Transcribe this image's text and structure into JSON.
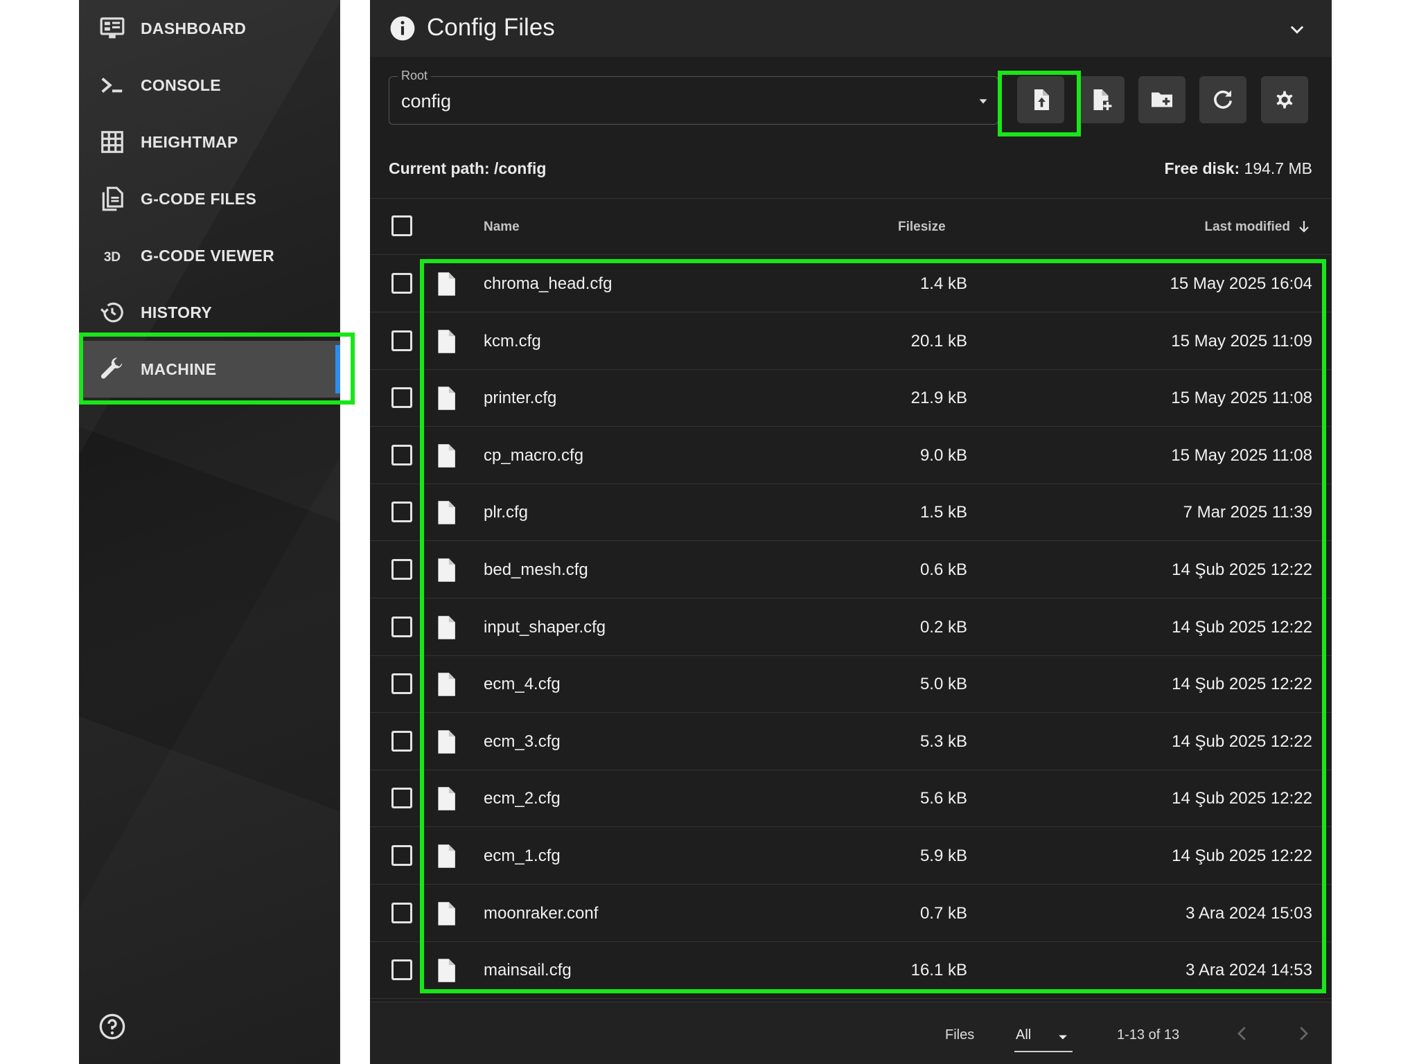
{
  "sidebar": {
    "items": [
      {
        "label": "DASHBOARD",
        "icon": "monitor-dashboard-icon"
      },
      {
        "label": "CONSOLE",
        "icon": "console-icon"
      },
      {
        "label": "HEIGHTMAP",
        "icon": "grid-icon"
      },
      {
        "label": "G-CODE FILES",
        "icon": "file-document-multiple-icon"
      },
      {
        "label": "G-CODE VIEWER",
        "icon": "3d-icon"
      },
      {
        "label": "HISTORY",
        "icon": "history-icon"
      },
      {
        "label": "MACHINE",
        "icon": "wrench-icon",
        "active": true
      }
    ]
  },
  "panel": {
    "title": "Config Files",
    "root_label": "Root",
    "root_value": "config",
    "current_path": "Current path: /config",
    "free_disk_label": "Free disk:",
    "free_disk_value": "194.7 MB"
  },
  "table": {
    "columns": {
      "name": "Name",
      "size": "Filesize",
      "modified": "Last modified"
    },
    "rows": [
      {
        "name": "chroma_head.cfg",
        "size": "1.4 kB",
        "date": "15 May 2025 16:04"
      },
      {
        "name": "kcm.cfg",
        "size": "20.1 kB",
        "date": "15 May 2025 11:09"
      },
      {
        "name": "printer.cfg",
        "size": "21.9 kB",
        "date": "15 May 2025 11:08"
      },
      {
        "name": "cp_macro.cfg",
        "size": "9.0 kB",
        "date": "15 May 2025 11:08"
      },
      {
        "name": "plr.cfg",
        "size": "1.5 kB",
        "date": "7 Mar 2025 11:39"
      },
      {
        "name": "bed_mesh.cfg",
        "size": "0.6 kB",
        "date": "14 Şub 2025 12:22"
      },
      {
        "name": "input_shaper.cfg",
        "size": "0.2 kB",
        "date": "14 Şub 2025 12:22"
      },
      {
        "name": "ecm_4.cfg",
        "size": "5.0 kB",
        "date": "14 Şub 2025 12:22"
      },
      {
        "name": "ecm_3.cfg",
        "size": "5.3 kB",
        "date": "14 Şub 2025 12:22"
      },
      {
        "name": "ecm_2.cfg",
        "size": "5.6 kB",
        "date": "14 Şub 2025 12:22"
      },
      {
        "name": "ecm_1.cfg",
        "size": "5.9 kB",
        "date": "14 Şub 2025 12:22"
      },
      {
        "name": "moonraker.conf",
        "size": "0.7 kB",
        "date": "3 Ara 2024 15:03"
      },
      {
        "name": "mainsail.cfg",
        "size": "16.1 kB",
        "date": "3 Ara 2024 14:53"
      }
    ]
  },
  "footer": {
    "files_label": "Files",
    "per_page": "All",
    "range": "1-13 of 13"
  },
  "colors": {
    "highlight": "#19e619",
    "active_indicator": "#2d8cf0"
  }
}
